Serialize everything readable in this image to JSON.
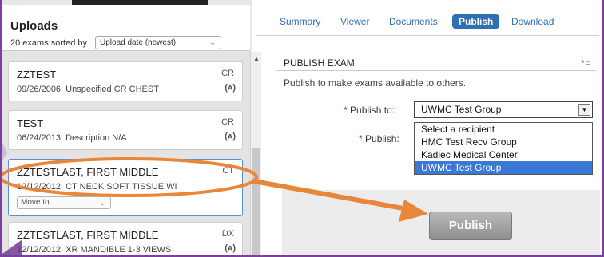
{
  "uploads": {
    "title": "Uploads",
    "sort_text": "20 exams sorted by",
    "sort_value": "Upload date (newest)"
  },
  "exams": [
    {
      "name": "ZZTEST",
      "detail": "09/26/2006, Unspecified CR CHEST",
      "modality": "CR",
      "icon": "(ᴀ)"
    },
    {
      "name": "TEST",
      "detail": "06/24/2013, Description N/A",
      "modality": "CR",
      "icon": "(ᴀ)"
    },
    {
      "name": "ZZTESTLAST, FIRST MIDDLE",
      "detail": "12/12/2012, CT NECK SOFT TISSUE WI",
      "modality": "CT",
      "move_label": "Move to"
    },
    {
      "name": "ZZTESTLAST, FIRST MIDDLE",
      "detail": "12/12/2012, XR MANDIBLE 1-3 VIEWS",
      "modality": "DX",
      "icon": "(ᴀ)"
    }
  ],
  "tabs": [
    "Summary",
    "Viewer",
    "Documents",
    "Publish",
    "Download"
  ],
  "active_tab": "Publish",
  "publish": {
    "section_title": "PUBLISH EXAM",
    "required_mark": "* =",
    "description": "Publish to make exams available to others.",
    "publish_to_label": "Publish to:",
    "publish_label": "Publish:",
    "required_star": "*",
    "selected_recipient": "UWMC Test Group",
    "options": [
      "Select a recipient",
      "HMC Test Recv Group",
      "Kadlec Medical Center",
      "UWMC Test Group"
    ],
    "button_label": "Publish"
  },
  "colors": {
    "annotation": "#e8863a",
    "frame": "#7b3fa0",
    "tab_active": "#2f6fb6",
    "dropdown_selected": "#3b78d6"
  }
}
